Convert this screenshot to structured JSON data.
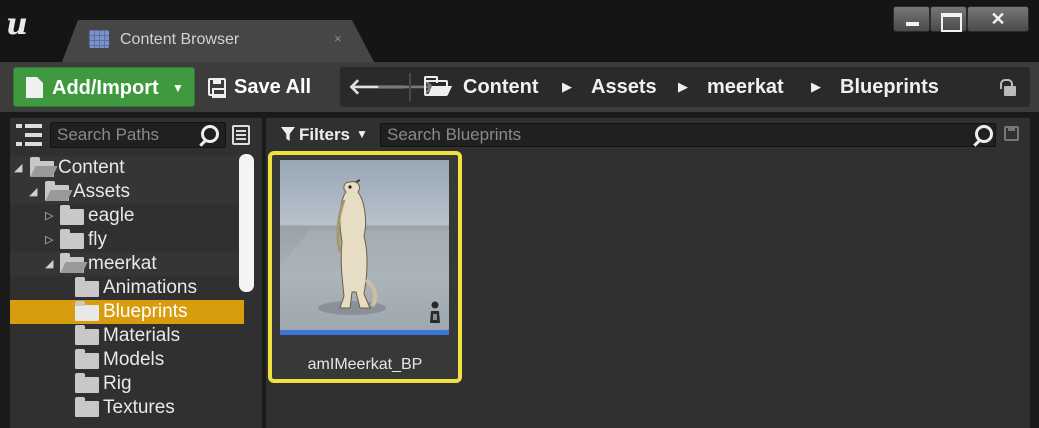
{
  "window": {
    "tab_title": "Content Browser",
    "tab_close": "×",
    "logo": "u"
  },
  "toolbar": {
    "add_import_label": "Add/Import",
    "save_all_label": "Save All",
    "breadcrumbs": [
      "Content",
      "Assets",
      "meerkat",
      "Blueprints"
    ]
  },
  "sidebar": {
    "search_placeholder": "Search Paths",
    "tree": [
      {
        "label": "Content",
        "depth": 0,
        "expanded": true
      },
      {
        "label": "Assets",
        "depth": 1,
        "expanded": true
      },
      {
        "label": "eagle",
        "depth": 2,
        "expanded": false
      },
      {
        "label": "fly",
        "depth": 2,
        "expanded": false
      },
      {
        "label": "meerkat",
        "depth": 2,
        "expanded": true
      },
      {
        "label": "Animations",
        "depth": 3
      },
      {
        "label": "Blueprints",
        "depth": 3,
        "selected": true
      },
      {
        "label": "Materials",
        "depth": 3
      },
      {
        "label": "Models",
        "depth": 3
      },
      {
        "label": "Rig",
        "depth": 3
      },
      {
        "label": "Textures",
        "depth": 3
      }
    ]
  },
  "content": {
    "filters_label": "Filters",
    "search_placeholder": "Search Blueprints",
    "assets": [
      {
        "name": "amIMeerkat_BP",
        "selected": true
      }
    ]
  },
  "colors": {
    "add_button": "#3f9a3f",
    "selection_folder": "#d89c0f",
    "asset_selection_border": "#f0e040",
    "asset_type_bar": "#3c74d8"
  },
  "icons": {
    "tab": "content-browser-icon",
    "add": "new-document-icon",
    "save": "floppy-disk-icon",
    "back": "arrow-left-icon",
    "forward": "arrow-right-icon",
    "breadcrumb_root": "folder-open-icon",
    "lock": "unlock-icon",
    "filters": "funnel-icon",
    "search": "search-icon",
    "save_search": "floppy-disk-icon",
    "actor": "actor-pawn-icon"
  }
}
